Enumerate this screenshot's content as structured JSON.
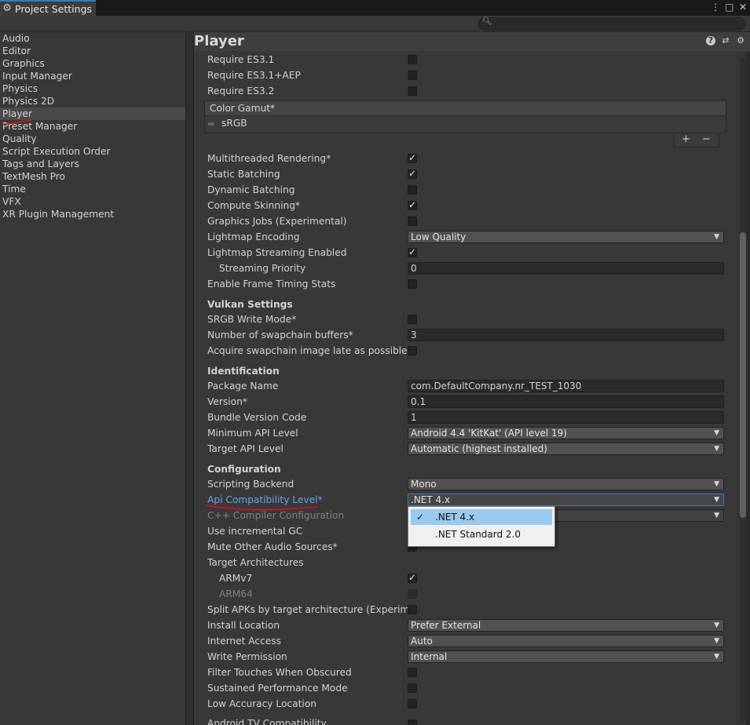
{
  "window": {
    "tab_title": "Project Settings",
    "icons": [
      "more-vert-icon",
      "maximize-icon",
      "close-icon"
    ],
    "search_placeholder": ""
  },
  "sidebar": {
    "items": [
      {
        "label": "Audio",
        "selected": false
      },
      {
        "label": "Editor",
        "selected": false
      },
      {
        "label": "Graphics",
        "selected": false
      },
      {
        "label": "Input Manager",
        "selected": false
      },
      {
        "label": "Physics",
        "selected": false
      },
      {
        "label": "Physics 2D",
        "selected": false
      },
      {
        "label": "Player",
        "selected": true
      },
      {
        "label": "Preset Manager",
        "selected": false
      },
      {
        "label": "Quality",
        "selected": false
      },
      {
        "label": "Script Execution Order",
        "selected": false
      },
      {
        "label": "Tags and Layers",
        "selected": false
      },
      {
        "label": "TextMesh Pro",
        "selected": false
      },
      {
        "label": "Time",
        "selected": false
      },
      {
        "label": "VFX",
        "selected": false
      },
      {
        "label": "XR Plugin Management",
        "selected": false
      }
    ]
  },
  "header": {
    "title": "Player",
    "icons": [
      "help-icon",
      "preset-sliders-icon",
      "settings-gear-icon"
    ]
  },
  "settings": {
    "es31": "Require ES3.1",
    "es31aep": "Require ES3.1+AEP",
    "es32": "Require ES3.2",
    "color_gamut": {
      "header": "Color Gamut*",
      "item": "sRGB",
      "add": "+",
      "remove": "−"
    },
    "multithreaded": "Multithreaded Rendering*",
    "static_batching": "Static Batching",
    "dynamic_batching": "Dynamic Batching",
    "compute_skinning": "Compute Skinning*",
    "graphics_jobs": "Graphics Jobs (Experimental)",
    "lightmap_encoding": {
      "label": "Lightmap Encoding",
      "value": "Low Quality"
    },
    "lightmap_streaming": "Lightmap Streaming Enabled",
    "streaming_priority": {
      "label": "Streaming Priority",
      "value": "0"
    },
    "frame_timing": "Enable Frame Timing Stats",
    "vulkan_header": "Vulkan Settings",
    "srgb_write": "SRGB Write Mode*",
    "swapchain": {
      "label": "Number of swapchain buffers*",
      "value": "3"
    },
    "acquire_late": "Acquire swapchain image late as possible*",
    "ident_header": "Identification",
    "package_name": {
      "label": "Package Name",
      "value": "com.DefaultCompany.nr_TEST_1030"
    },
    "version": {
      "label": "Version*",
      "value": "0.1"
    },
    "bundle_code": {
      "label": "Bundle Version Code",
      "value": "1"
    },
    "min_api": {
      "label": "Minimum API Level",
      "value": "Android 4.4 'KitKat' (API level 19)"
    },
    "target_api": {
      "label": "Target API Level",
      "value": "Automatic (highest installed)"
    },
    "config_header": "Configuration",
    "scripting_backend": {
      "label": "Scripting Backend",
      "value": "Mono"
    },
    "api_compat": {
      "label": "Api Compatibility Level*",
      "value": ".NET 4.x"
    },
    "cpp_compiler": "C++ Compiler Configuration",
    "incremental_gc": "Use incremental GC",
    "mute_audio": "Mute Other Audio Sources*",
    "target_arch": "Target Architectures",
    "armv7": "ARMv7",
    "arm64": "ARM64",
    "split_apks": "Split APKs by target architecture (Experimental)",
    "install_location": {
      "label": "Install Location",
      "value": "Prefer External"
    },
    "internet_access": {
      "label": "Internet Access",
      "value": "Auto"
    },
    "write_permission": {
      "label": "Write Permission",
      "value": "Internal"
    },
    "filter_touches": "Filter Touches When Obscured",
    "sustained_perf": "Sustained Performance Mode",
    "low_accuracy": "Low Accuracy Location",
    "android_tv": "Android TV Compatibility"
  },
  "popup": {
    "options": [
      {
        "label": ".NET 4.x",
        "selected": true
      },
      {
        "label": ".NET Standard 2.0",
        "selected": false
      }
    ]
  },
  "annotation_color": "#e01010"
}
